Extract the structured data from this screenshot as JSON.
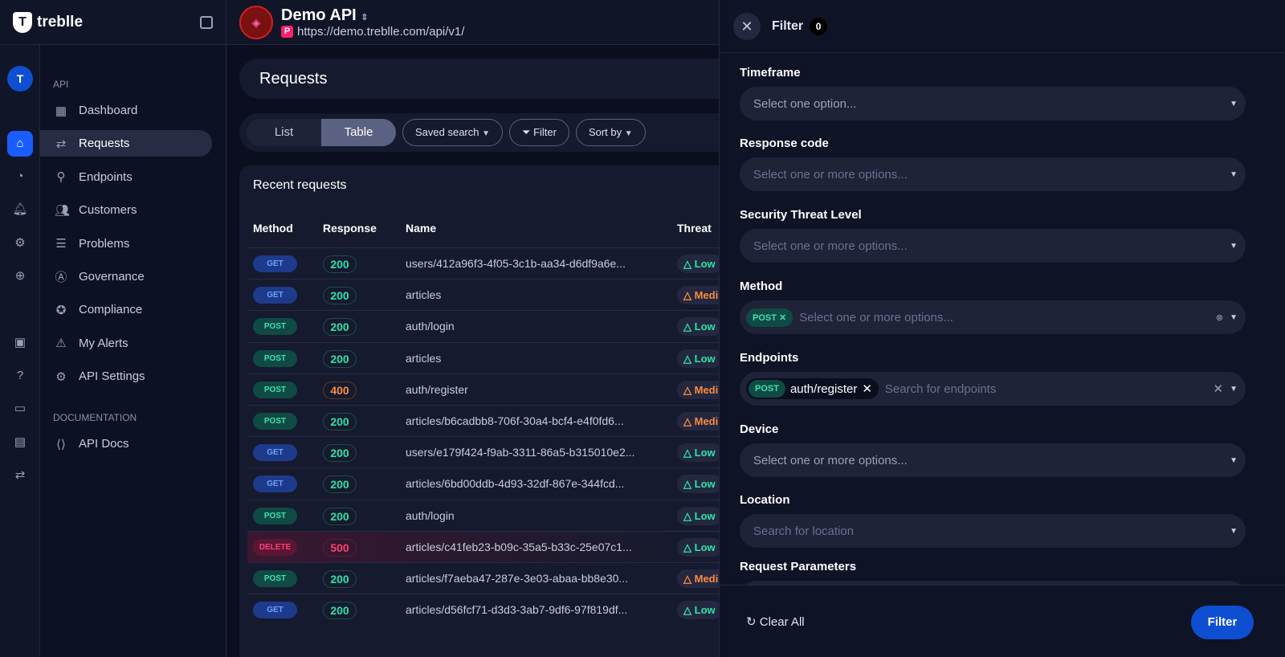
{
  "brand": {
    "name": "treblle"
  },
  "header": {
    "api_name": "Demo API",
    "url": "https://demo.treblle.com/api/v1/",
    "url_badge": "P"
  },
  "nav": {
    "section_api": "API",
    "section_docs": "DOCUMENTATION",
    "items": [
      {
        "label": "Dashboard",
        "icon": "grid-icon"
      },
      {
        "label": "Requests",
        "icon": "arrows-icon"
      },
      {
        "label": "Endpoints",
        "icon": "endpoints-icon"
      },
      {
        "label": "Customers",
        "icon": "users-icon"
      },
      {
        "label": "Problems",
        "icon": "list-icon"
      },
      {
        "label": "Governance",
        "icon": "governance-icon"
      },
      {
        "label": "Compliance",
        "icon": "badge-icon"
      },
      {
        "label": "My Alerts",
        "icon": "warning-icon"
      },
      {
        "label": "API Settings",
        "icon": "gear-icon"
      }
    ],
    "docs": [
      {
        "label": "API Docs",
        "icon": "file-code-icon"
      }
    ]
  },
  "page": {
    "title": "Requests",
    "view_list": "List",
    "view_table": "Table",
    "saved_search": "Saved search",
    "filter": "Filter",
    "sort_by": "Sort by"
  },
  "table": {
    "title": "Recent requests",
    "columns": [
      "Method",
      "Response",
      "Name",
      "Threat"
    ],
    "rows": [
      {
        "method": "GET",
        "code": "200",
        "name": "users/412a96f3-4f05-3c1b-aa34-d6df9a6e...",
        "threat": "Low"
      },
      {
        "method": "GET",
        "code": "200",
        "name": "articles",
        "threat": "Medium"
      },
      {
        "method": "POST",
        "code": "200",
        "name": "auth/login",
        "threat": "Low"
      },
      {
        "method": "POST",
        "code": "200",
        "name": "articles",
        "threat": "Low"
      },
      {
        "method": "POST",
        "code": "400",
        "name": "auth/register",
        "threat": "Medium"
      },
      {
        "method": "POST",
        "code": "200",
        "name": "articles/b6cadbb8-706f-30a4-bcf4-e4f0fd6...",
        "threat": "Medium"
      },
      {
        "method": "GET",
        "code": "200",
        "name": "users/e179f424-f9ab-3311-86a5-b315010e2...",
        "threat": "Low"
      },
      {
        "method": "GET",
        "code": "200",
        "name": "articles/6bd00ddb-4d93-32df-867e-344fcd...",
        "threat": "Low"
      },
      {
        "method": "POST",
        "code": "200",
        "name": "auth/login",
        "threat": "Low"
      },
      {
        "method": "DELETE",
        "code": "500",
        "name": "articles/c41feb23-b09c-35a5-b33c-25e07c1...",
        "threat": "Low"
      },
      {
        "method": "POST",
        "code": "200",
        "name": "articles/f7aeba47-287e-3e03-abaa-bb8e30...",
        "threat": "Medium"
      },
      {
        "method": "GET",
        "code": "200",
        "name": "articles/d56fcf71-d3d3-3ab7-9df6-97f819df...",
        "threat": "Low"
      }
    ]
  },
  "filter": {
    "title": "Filter",
    "count": "0",
    "fields": [
      {
        "label": "Timeframe",
        "placeholder": "Select one option..."
      },
      {
        "label": "Response code",
        "placeholder": "Select one or more options..."
      },
      {
        "label": "Security Threat Level",
        "placeholder": "Select one or more options..."
      },
      {
        "label": "Method",
        "placeholder": "Select one or more options...",
        "chip": "POST"
      },
      {
        "label": "Endpoints",
        "placeholder": "Search for endpoints",
        "chip_method": "POST",
        "chip_path": "auth/register"
      },
      {
        "label": "Device",
        "placeholder": "Select one or more options..."
      },
      {
        "label": "Location",
        "placeholder": "Search for location"
      },
      {
        "label": "Request Parameters"
      }
    ],
    "clear_all": "Clear All",
    "apply": "Filter"
  },
  "colors": {
    "accent": "#0e4fd1",
    "get": "#6ea0ff",
    "post": "#3fe0b0",
    "delete": "#ff3f7a",
    "ok": "#2de3a8",
    "warn": "#ff8a3d"
  }
}
